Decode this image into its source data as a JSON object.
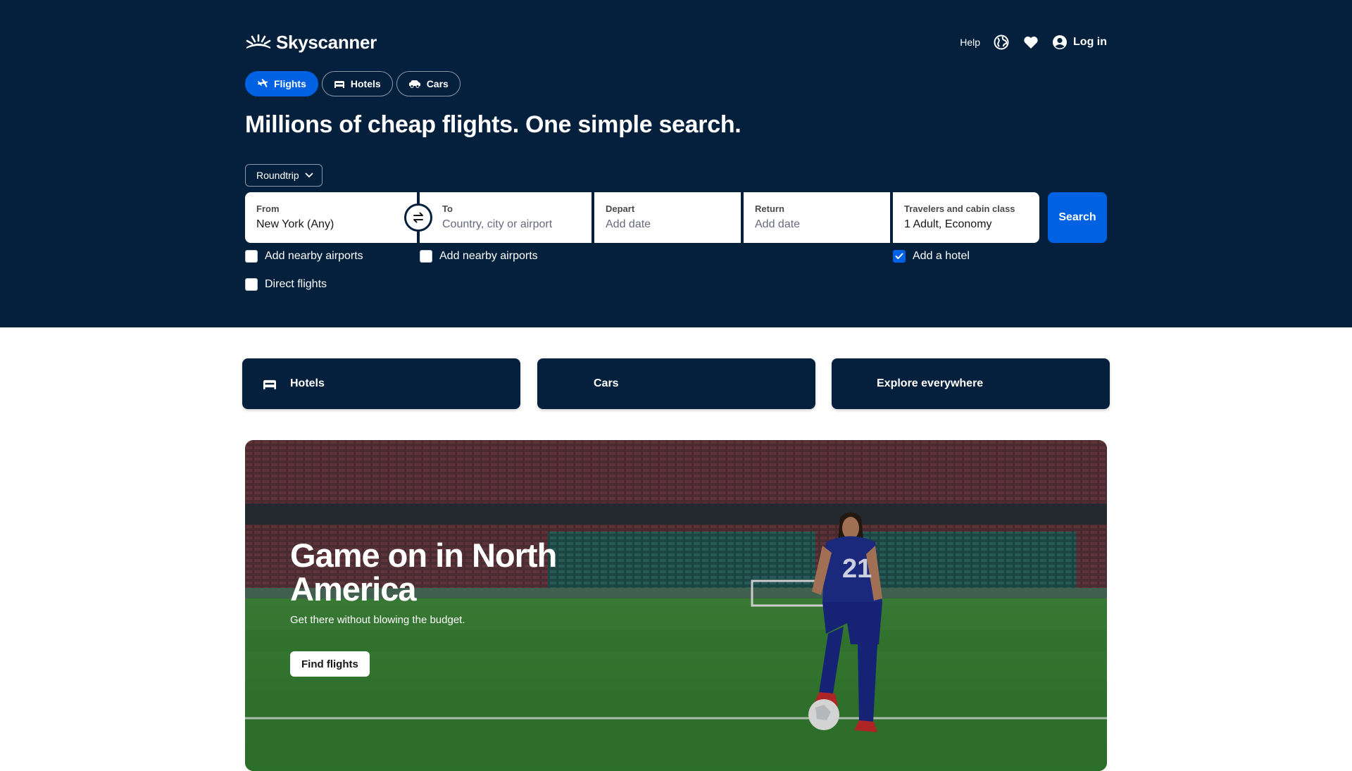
{
  "brand": {
    "name": "Skyscanner"
  },
  "header": {
    "help": "Help",
    "login": "Log in"
  },
  "tabs": [
    {
      "label": "Flights",
      "icon": "plane-icon",
      "active": true
    },
    {
      "label": "Hotels",
      "icon": "bed-icon",
      "active": false
    },
    {
      "label": "Cars",
      "icon": "car-icon",
      "active": false
    }
  ],
  "headline": "Millions of cheap flights. One simple search.",
  "trip_type": {
    "value": "Roundtrip"
  },
  "search": {
    "from": {
      "label": "From",
      "value": "New York (Any)"
    },
    "to": {
      "label": "To",
      "placeholder": "Country, city or airport"
    },
    "depart": {
      "label": "Depart",
      "placeholder": "Add date"
    },
    "return": {
      "label": "Return",
      "placeholder": "Add date"
    },
    "travelers": {
      "label": "Travelers and cabin class",
      "value": "1 Adult, Economy"
    },
    "button": "Search"
  },
  "options": {
    "nearby_from": {
      "label": "Add nearby airports",
      "checked": false
    },
    "nearby_to": {
      "label": "Add nearby airports",
      "checked": false
    },
    "direct": {
      "label": "Direct flights",
      "checked": false
    },
    "hotel": {
      "label": "Add a hotel",
      "checked": true
    }
  },
  "quick_links": [
    {
      "label": "Hotels",
      "icon": "bed-icon"
    },
    {
      "label": "Cars",
      "icon": ""
    },
    {
      "label": "Explore everywhere",
      "icon": ""
    }
  ],
  "promo": {
    "title": "Game on in North America",
    "subtitle": "Get there without blowing the budget.",
    "button": "Find flights"
  },
  "colors": {
    "navy": "#05203c",
    "blue": "#0062e3",
    "white": "#ffffff"
  }
}
